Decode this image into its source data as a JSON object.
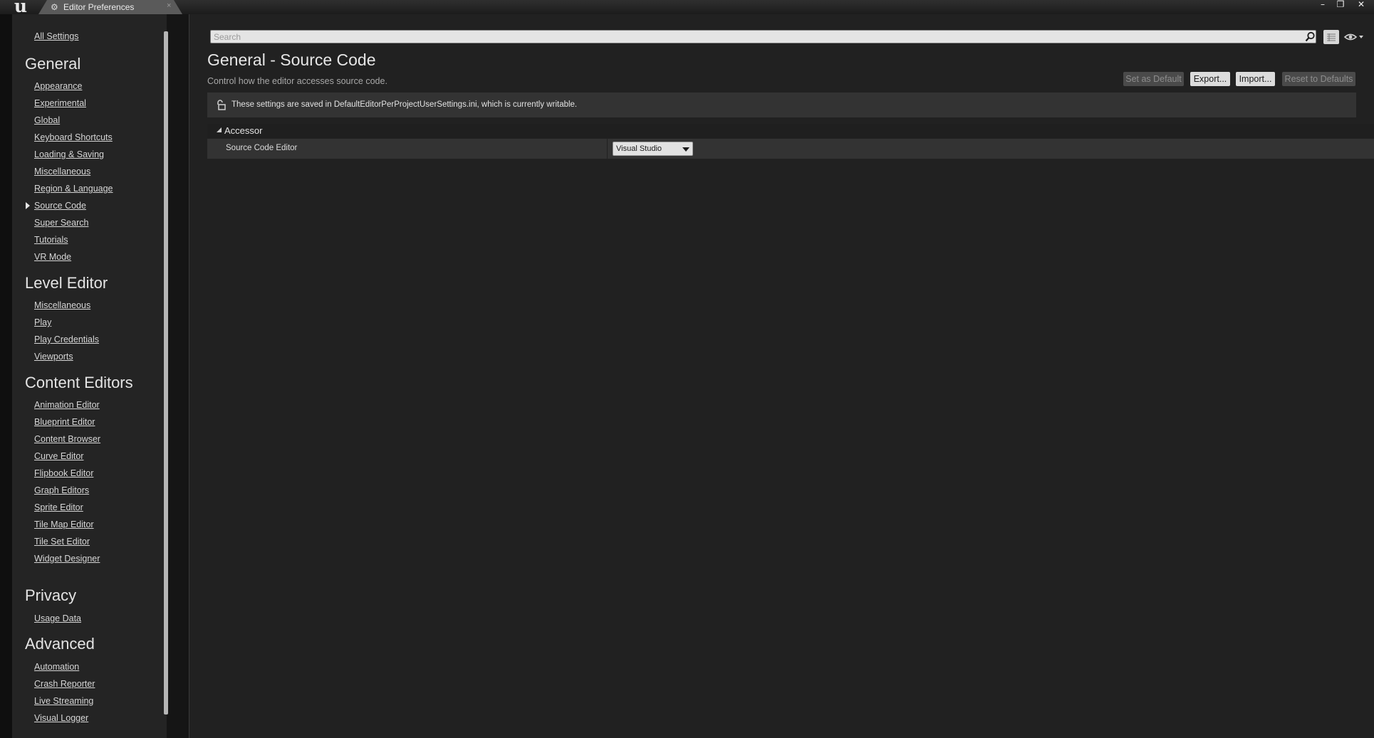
{
  "window": {
    "tab_title": "Editor Preferences",
    "tab_close": "×",
    "logo_text": "u",
    "tab_icon": "⚙",
    "controls": {
      "minimize": "–",
      "maximize": "❐",
      "close": "✕"
    }
  },
  "sidebar": {
    "all_settings": "All Settings",
    "sections": [
      {
        "title": "General",
        "items": [
          "Appearance",
          "Experimental",
          "Global",
          "Keyboard Shortcuts",
          "Loading & Saving",
          "Miscellaneous",
          "Region & Language",
          "Source Code",
          "Super Search",
          "Tutorials",
          "VR Mode"
        ]
      },
      {
        "title": "Level Editor",
        "items": [
          "Miscellaneous",
          "Play",
          "Play Credentials",
          "Viewports"
        ]
      },
      {
        "title": "Content Editors",
        "items": [
          "Animation Editor",
          "Blueprint Editor",
          "Content Browser",
          "Curve Editor",
          "Flipbook Editor",
          "Graph Editors",
          "Sprite Editor",
          "Tile Map Editor",
          "Tile Set Editor",
          "Widget Designer"
        ]
      },
      {
        "title": "Privacy",
        "items": [
          "Usage Data"
        ]
      },
      {
        "title": "Advanced",
        "items": [
          "Automation",
          "Crash Reporter",
          "Live Streaming",
          "Visual Logger"
        ]
      }
    ],
    "selected": "Source Code"
  },
  "search": {
    "placeholder": "Search",
    "value": ""
  },
  "main": {
    "title": "General - Source Code",
    "description": "Control how the editor accesses source code.",
    "buttons": {
      "set_as_default": "Set as Default",
      "export": "Export...",
      "import": "Import...",
      "reset": "Reset to Defaults"
    },
    "notice": "These settings are saved in DefaultEditorPerProjectUserSettings.ini, which is currently writable.",
    "category": "Accessor",
    "property": {
      "label": "Source Code Editor",
      "value": "Visual Studio"
    }
  },
  "colors": {
    "background": "#212121",
    "sidebar": "#242424",
    "notice": "#333333",
    "button_enabled": "#dcdcdc",
    "button_disabled": "#4a4a4a"
  }
}
